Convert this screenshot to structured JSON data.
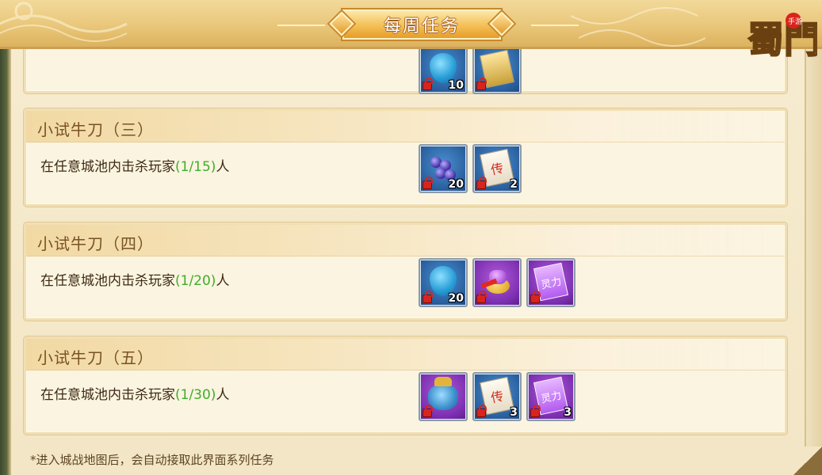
{
  "header": {
    "title": "每周任务",
    "logo_text": "蜀門",
    "logo_badge": "手游"
  },
  "partial_card": {
    "rewards": [
      {
        "icon": "gourd-icon",
        "quantity": "10",
        "bg": "blue"
      },
      {
        "icon": "scroll-gold-icon",
        "quantity": "",
        "bg": "blue"
      }
    ]
  },
  "tasks": [
    {
      "title": "小试牛刀（三）",
      "desc_prefix": "在任意城池内击杀玩家",
      "progress": "(1/15)",
      "desc_suffix": "人",
      "rewards": [
        {
          "icon": "grapes-icon",
          "quantity": "20",
          "bg": "blue"
        },
        {
          "icon": "scroll-chuan-icon",
          "label": "传",
          "quantity": "2",
          "bg": "blue"
        }
      ]
    },
    {
      "title": "小试牛刀（四）",
      "desc_prefix": "在任意城池内击杀玩家",
      "progress": "(1/20)",
      "desc_suffix": "人",
      "rewards": [
        {
          "icon": "gourd-icon",
          "quantity": "20",
          "bg": "blue"
        },
        {
          "icon": "treasure-fruit-icon",
          "quantity": "",
          "bg": "purple"
        },
        {
          "icon": "scroll-lingli-icon",
          "label": "灵力",
          "quantity": "",
          "bg": "purple"
        }
      ]
    },
    {
      "title": "小试牛刀（五）",
      "desc_prefix": "在任意城池内击杀玩家",
      "progress": "(1/30)",
      "desc_suffix": "人",
      "rewards": [
        {
          "icon": "pouch-icon",
          "quantity": "",
          "bg": "purple"
        },
        {
          "icon": "scroll-chuan-icon",
          "label": "传",
          "quantity": "3",
          "bg": "blue"
        },
        {
          "icon": "scroll-lingli-icon",
          "label": "灵力",
          "quantity": "3",
          "bg": "purple"
        }
      ]
    }
  ],
  "footer": {
    "note": "*进入城战地图后，会自动接取此界面系列任务"
  }
}
